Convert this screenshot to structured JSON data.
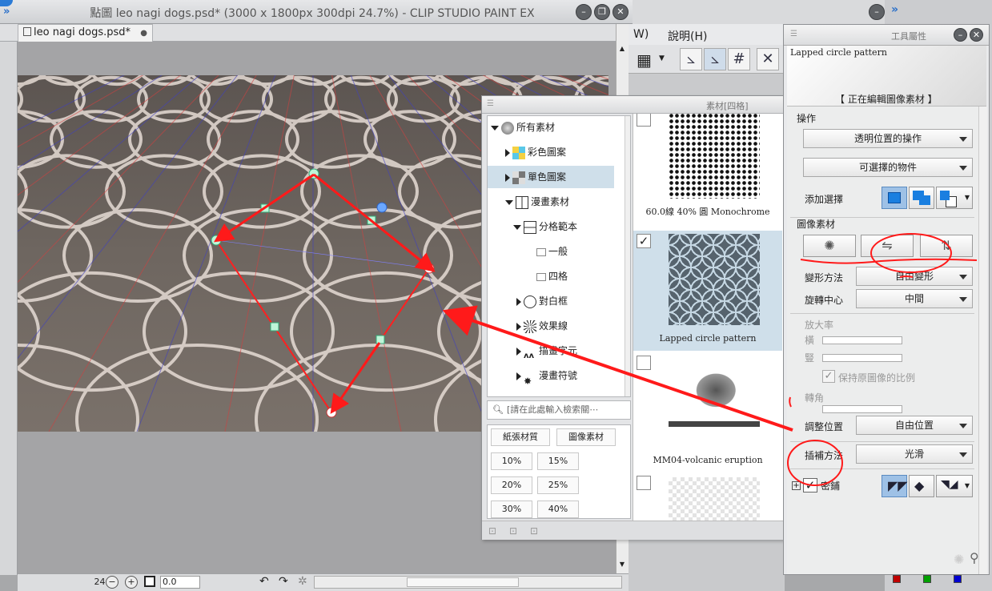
{
  "window": {
    "title": "點圖 leo nagi dogs.psd* (3000 x 1800px 300dpi 24.7%) - CLIP STUDIO PAINT EX",
    "tab_label": "leo nagi dogs.psd*",
    "tab_close": "●"
  },
  "menu": {
    "items": [
      "W)",
      "說明(H)"
    ]
  },
  "status": {
    "zoom": "24.7",
    "angle": "0.0"
  },
  "material_panel": {
    "title": "素材[四格]",
    "tree": [
      {
        "label": "所有素材",
        "level": 0,
        "expand": "down"
      },
      {
        "label": "彩色圖案",
        "level": 1,
        "expand": "right"
      },
      {
        "label": "單色圖案",
        "level": 1,
        "expand": "right",
        "selected": true
      },
      {
        "label": "漫畫素材",
        "level": 1,
        "expand": "down"
      },
      {
        "label": "分格範本",
        "level": 2,
        "expand": "down"
      },
      {
        "label": "一般",
        "level": 3,
        "expand": "none"
      },
      {
        "label": "四格",
        "level": 3,
        "expand": "none"
      },
      {
        "label": "對白框",
        "level": 2,
        "expand": "right"
      },
      {
        "label": "效果線",
        "level": 2,
        "expand": "right"
      },
      {
        "label": "描畫字元",
        "level": 2,
        "expand": "right"
      },
      {
        "label": "漫畫符號",
        "level": 2,
        "expand": "right"
      }
    ],
    "search_placeholder": "[請在此處輸入檢索關⋯",
    "tag_headers": [
      "紙張材質",
      "圖像素材"
    ],
    "tags": [
      "10%",
      "15%",
      "20%",
      "25%",
      "30%",
      "40%"
    ],
    "items": [
      {
        "caption": "60.0線 40% 圓 Monochrome",
        "checked": false
      },
      {
        "caption": "Lapped circle pattern",
        "checked": true
      },
      {
        "caption": "MM04-volcanic eruption",
        "checked": false
      },
      {
        "caption": "",
        "checked": false
      }
    ]
  },
  "tool_property": {
    "title": "工具屬性",
    "preview_name": "Lapped circle pattern",
    "editing_label": "【 正在編輯圖像素材 】",
    "section_operation": "操作",
    "dd_transparent": "透明位置的操作",
    "dd_selectable": "可選擇的物件",
    "add_selection": "添加選擇",
    "section_image": "圖像素材",
    "transform_label": "變形方法",
    "transform_value": "自由變形",
    "rotate_center_label": "旋轉中心",
    "rotate_center_value": "中間",
    "scale_label": "放大率",
    "scale_h": "橫",
    "scale_v": "豎",
    "keep_ratio": "保持原圖像的比例",
    "rotation_label": "轉角",
    "adjust_pos_label": "調整位置",
    "adjust_pos_value": "自由位置",
    "interp_label": "插補方法",
    "interp_value": "光滑",
    "tile_label": "密鋪",
    "tile_expand": "+"
  },
  "colors": {
    "accent_blue": "#1a7fe0",
    "annotation_red": "#ff1a1a",
    "selection_bg": "#cfdfea"
  }
}
